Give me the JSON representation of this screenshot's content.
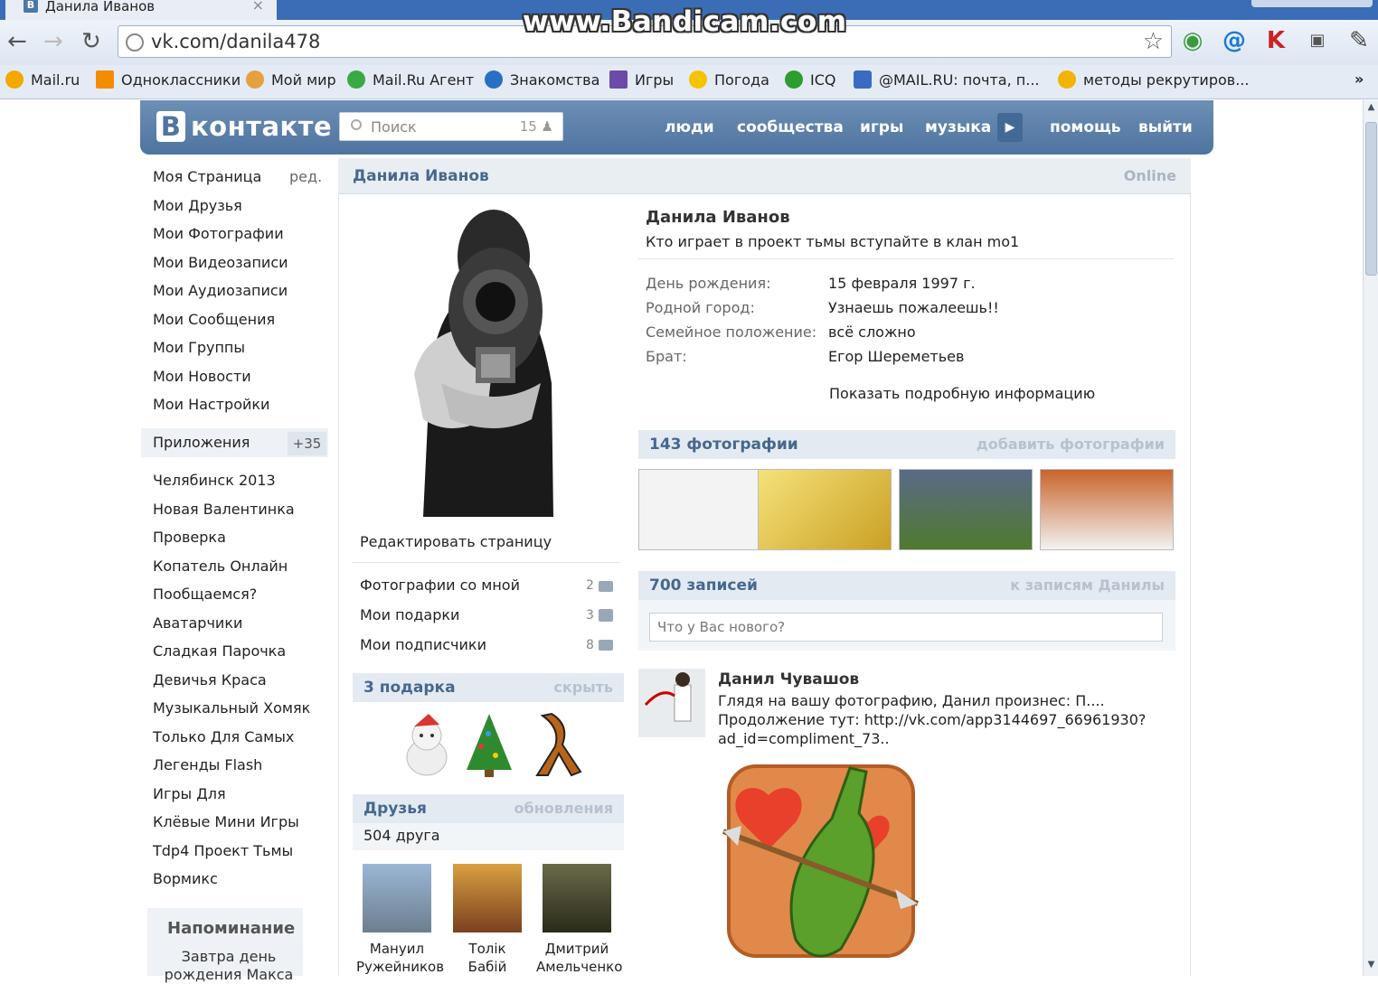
{
  "browser": {
    "tab_title": "Данила Иванов",
    "watermark": "www.Bandicam.com",
    "url": "vk.com/danila478",
    "bookmarks": [
      "Mail.ru",
      "Одноклассники",
      "Мой мир",
      "Mail.Ru Агент",
      "Знакомства",
      "Игры",
      "Погода",
      "ICQ",
      "@MAIL.RU: почта, п...",
      "методы рекрутиров..."
    ],
    "bookmarks_more": "»"
  },
  "vk": {
    "logo": "контакте",
    "logo_letter": "В",
    "search_placeholder": "Поиск",
    "search_count": "15",
    "nav": [
      "люди",
      "сообщества",
      "игры",
      "музыка",
      "помощь",
      "выйти"
    ]
  },
  "left_menu": {
    "items": [
      "Моя Страница",
      "Мои Друзья",
      "Мои Фотографии",
      "Мои Видеозаписи",
      "Мои Аудиозаписи",
      "Мои Сообщения",
      "Мои Группы",
      "Мои Новости",
      "Мои Настройки"
    ],
    "edit": "ред.",
    "apps_label": "Приложения",
    "apps_badge": "+35",
    "apps": [
      "Челябинск 2013",
      "Новая Валентинка",
      "Проверка",
      "Копатель Онлайн",
      "Пообщаемся?",
      "Аватарчики",
      "Сладкая Парочка",
      "Девичья Краса",
      "Музыкальный Хомяк",
      "Только Для Самых",
      "Легенды Flash",
      "Игры Для",
      "Клёвые Мини Игры",
      "Tdp4 Проект Тьмы",
      "Вормикс"
    ],
    "reminder_title": "Напоминание",
    "reminder_text": "Завтра день рождения Макса"
  },
  "profile": {
    "header_name": "Данила Иванов",
    "header_status": "Online",
    "full_name": "Данила Иванов",
    "status": "Кто играет в проект тьмы вступайте в клан mo1",
    "info": [
      {
        "label": "День рождения:",
        "value": "15 февраля 1997 г."
      },
      {
        "label": "Родной город:",
        "value": "Узнаешь пожалеешь!!"
      },
      {
        "label": "Семейное положение:",
        "value": "всё сложно"
      },
      {
        "label": "Брат:",
        "value": "Егор Шереметьев"
      }
    ],
    "more_info": "Показать подробную информацию",
    "edit_page": "Редактировать страницу",
    "side_actions": [
      {
        "label": "Фотографии со мной",
        "count": "2"
      },
      {
        "label": "Мои подарки",
        "count": "3"
      },
      {
        "label": "Мои подписчики",
        "count": "8"
      }
    ],
    "gifts_title": "3 подарка",
    "gifts_hide": "скрыть",
    "friends_title": "Друзья",
    "friends_updates": "обновления",
    "friends_count": "504 друга",
    "friends": [
      {
        "first": "Мануил",
        "last": "Ружейников"
      },
      {
        "first": "Толік",
        "last": "Бабій"
      },
      {
        "first": "Дмитрий",
        "last": "Амельченко"
      }
    ],
    "photos_title": "143 фотографии",
    "photos_add": "добавить фотографии",
    "wall_title": "700 записей",
    "wall_link": "к записям Данилы",
    "wall_placeholder": "Что у Вас нового?",
    "post_author": "Данил Чувашов",
    "post_lines": [
      "Глядя на вашу фотографию, Данил произнес: П....",
      "Продолжение тут: http://vk.com/app3144697_66961930?",
      "ad_id=compliment_73.."
    ]
  },
  "colors": {
    "vk_blue": "#4e74a0",
    "link_blue": "#45688e",
    "header_bg": "#e9eef3"
  }
}
